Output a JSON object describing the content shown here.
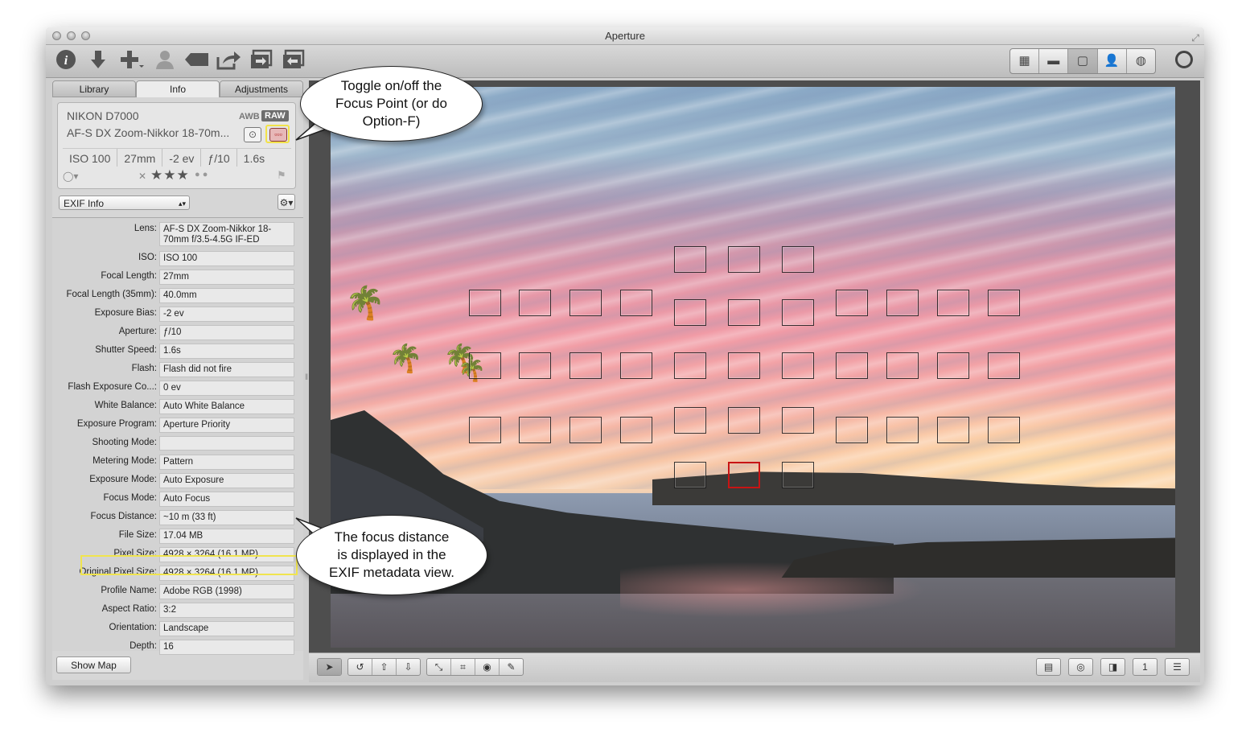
{
  "window": {
    "title": "Aperture"
  },
  "toolbar": {
    "left_icons": [
      "info-icon",
      "import-icon",
      "add-icon",
      "faces-icon",
      "keyword-icon",
      "share-icon",
      "export-icon",
      "import-from-icon"
    ],
    "view_modes": [
      "grid-view-icon",
      "split-view-icon",
      "viewer-icon",
      "faces-view-icon",
      "places-view-icon"
    ],
    "active_view": 2
  },
  "tabs": [
    "Library",
    "Info",
    "Adjustments"
  ],
  "active_tab": 1,
  "camera": {
    "model": "NIKON D7000",
    "lens": "AF-S DX Zoom-Nikkor 18-70m...",
    "awb": "AWB",
    "raw": "RAW",
    "iso": "ISO 100",
    "focal": "27mm",
    "ev": "-2 ev",
    "aperture": "ƒ/10",
    "shutter": "1.6s",
    "rating_stars": "★★★",
    "rating": 3
  },
  "exif_view": {
    "selected": "EXIF Info"
  },
  "exif": [
    {
      "label": "Lens:",
      "value": "AF-S DX Zoom-Nikkor 18-70mm f/3.5-4.5G IF-ED"
    },
    {
      "label": "ISO:",
      "value": "ISO 100"
    },
    {
      "label": "Focal Length:",
      "value": "27mm"
    },
    {
      "label": "Focal Length (35mm):",
      "value": "40.0mm"
    },
    {
      "label": "Exposure Bias:",
      "value": "-2 ev"
    },
    {
      "label": "Aperture:",
      "value": "ƒ/10"
    },
    {
      "label": "Shutter Speed:",
      "value": "1.6s"
    },
    {
      "label": "Flash:",
      "value": "Flash did not fire"
    },
    {
      "label": "Flash Exposure Co...:",
      "value": "0 ev"
    },
    {
      "label": "White Balance:",
      "value": "Auto White Balance"
    },
    {
      "label": "Exposure Program:",
      "value": "Aperture Priority"
    },
    {
      "label": "Shooting Mode:",
      "value": ""
    },
    {
      "label": "Metering Mode:",
      "value": "Pattern"
    },
    {
      "label": "Exposure Mode:",
      "value": "Auto Exposure"
    },
    {
      "label": "Focus Mode:",
      "value": "Auto Focus"
    },
    {
      "label": "Focus Distance:",
      "value": "~10 m (33 ft)"
    },
    {
      "label": "File Size:",
      "value": "17.04 MB"
    },
    {
      "label": "Pixel Size:",
      "value": "4928 × 3264 (16.1 MP)"
    },
    {
      "label": "Original Pixel Size:",
      "value": "4928 × 3264 (16.1 MP)"
    },
    {
      "label": "Profile Name:",
      "value": "Adobe RGB (1998)"
    },
    {
      "label": "Aspect Ratio:",
      "value": "3:2"
    },
    {
      "label": "Orientation:",
      "value": "Landscape"
    },
    {
      "label": "Depth:",
      "value": "16"
    }
  ],
  "show_map_label": "Show Map",
  "callouts": {
    "focus_toggle": "Toggle on/off the\nFocus Point (or do\nOption-F)",
    "focus_distance": "The focus distance\nis displayed in the\nEXIF metadata view."
  },
  "colors": {
    "highlight": "#f0e44e",
    "active_focus_point": "#c81414"
  },
  "bottom_tools": [
    "select-tool-icon",
    "rotate-left-icon",
    "lift-icon",
    "stamp-icon",
    "straighten-icon",
    "crop-icon",
    "red-eye-icon",
    "brush-icon"
  ]
}
